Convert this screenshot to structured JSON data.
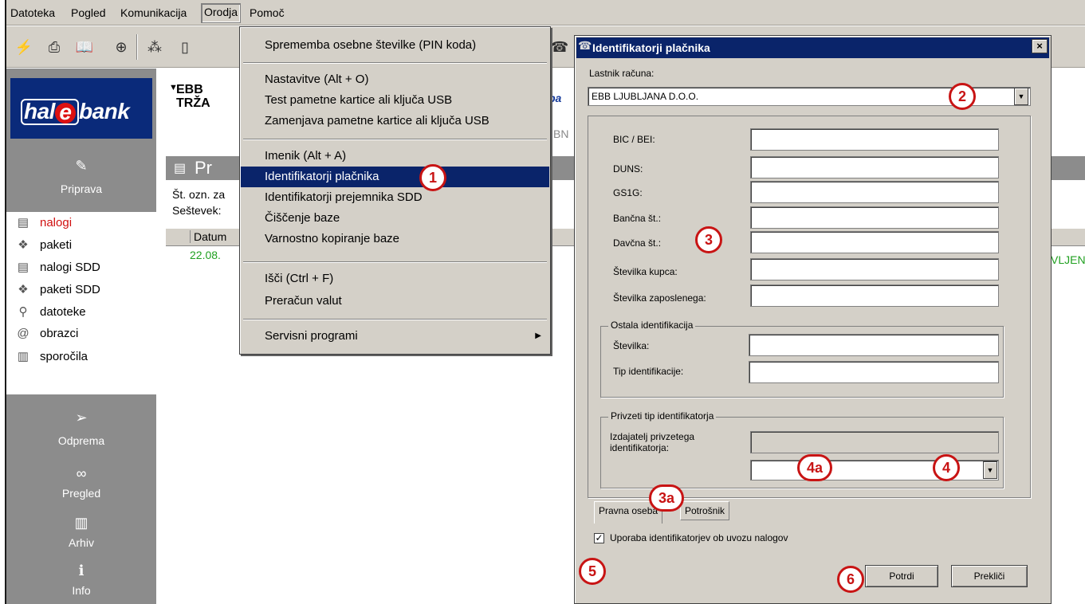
{
  "menubar": {
    "items": [
      "Datoteka",
      "Pogled",
      "Komunikacija",
      "Orodja",
      "Pomoč"
    ]
  },
  "logo": {
    "pre": "hal",
    "e": "e",
    "post": "bank"
  },
  "sidebar": {
    "priprava_label": "Priprava",
    "items": [
      {
        "label": "nalogi"
      },
      {
        "label": "paketi"
      },
      {
        "label": "nalogi SDD"
      },
      {
        "label": "paketi SDD"
      },
      {
        "label": "datoteke"
      },
      {
        "label": "obrazci"
      },
      {
        "label": "sporočila"
      }
    ],
    "odprema_label": "Odprema",
    "pregled_label": "Pregled",
    "arhiv_label": "Arhiv",
    "info_label": "Info"
  },
  "main": {
    "header_line1": "EBB",
    "header_line2": "TRŽA",
    "section_title": "Pr",
    "line1": "Št. ozn. za",
    "line2": "Seštevek:",
    "grid_col": "Datum",
    "grid_date": "22.08.",
    "right_green": "VLJEN",
    "partial_ba": "ba",
    "partial_bn": "BN"
  },
  "orodja_menu": {
    "items": [
      "Sprememba osebne številke (PIN koda)",
      "Nastavitve (Alt + O)",
      "Test pametne kartice ali ključa USB",
      "Zamenjava pametne kartice ali ključa USB",
      "Imenik (Alt + A)",
      "Identifikatorji plačnika",
      "Identifikatorji prejemnika SDD",
      "Čiščenje baze",
      "Varnostno kopiranje baze",
      "Išči (Ctrl + F)",
      "Preračun valut",
      "Servisni programi"
    ]
  },
  "dialog": {
    "title": "Identifikatorji plačnika",
    "close": "×",
    "owner_label": "Lastnik računa:",
    "owner_value": "EBB LJUBLJANA D.O.O.",
    "fields": [
      {
        "label": "BIC / BEI:",
        "value": ""
      },
      {
        "label": "DUNS:",
        "value": ""
      },
      {
        "label": "GS1G:",
        "value": ""
      },
      {
        "label": "Bančna št.:",
        "value": ""
      },
      {
        "label": "Davčna št.:",
        "value": ""
      },
      {
        "label": "Številka kupca:",
        "value": ""
      },
      {
        "label": "Številka zaposlenega:",
        "value": ""
      }
    ],
    "other_group_title": "Ostala identifikacija",
    "other_fields": [
      {
        "label": "Številka:",
        "value": ""
      },
      {
        "label": "Tip identifikacije:",
        "value": ""
      }
    ],
    "assumed_group_title": "Privzeti tip identifikatorja",
    "issuer_label_line1": "Izdajatelj privzetega",
    "issuer_label_line2": "identifikatorja:",
    "tabs": [
      "Pravna oseba",
      "Potrošnik"
    ],
    "checkbox_label": "Uporaba identifikatorjev ob uvozu nalogov",
    "checkbox_checked": true,
    "confirm_label": "Potrdi",
    "cancel_label": "Prekliči"
  },
  "callouts": [
    "1",
    "2",
    "3",
    "3a",
    "4",
    "4a",
    "5",
    "6"
  ]
}
